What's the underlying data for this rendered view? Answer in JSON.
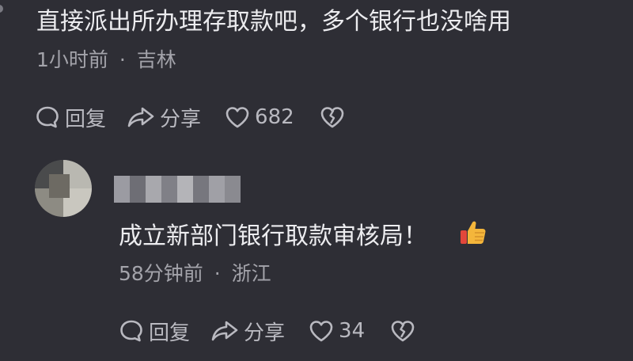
{
  "comment1": {
    "text": "直接派出所办理存取款吧，多个银行也没啥用",
    "time": "1小时前",
    "separator": "·",
    "location": "吉林",
    "reply_label": "回复",
    "share_label": "分享",
    "like_count": "682",
    "icons": [
      "comment-bubble-icon",
      "share-arrow-icon",
      "heart-icon",
      "broken-heart-icon"
    ]
  },
  "reply1": {
    "text": "成立新部门银行取款审核局！",
    "emoji": "thumbs-up-emoji",
    "time": "58分钟前",
    "separator": "·",
    "location": "浙江",
    "reply_label": "回复",
    "share_label": "分享",
    "like_count": "34",
    "icons": [
      "comment-bubble-icon",
      "share-arrow-icon",
      "heart-icon",
      "broken-heart-icon"
    ]
  },
  "colors": {
    "background": "#2e2e35",
    "text_primary": "#ececef",
    "text_secondary": "#a3a3aa",
    "icon": "#b9b9c0"
  }
}
